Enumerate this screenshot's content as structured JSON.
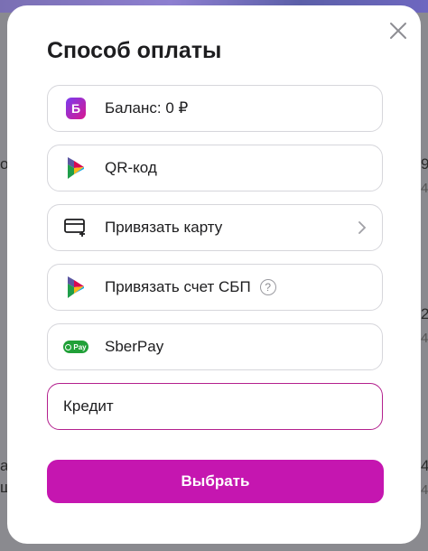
{
  "background": {
    "left_fragments": [
      "о",
      "а",
      "ш"
    ],
    "right_fragments": [
      "9",
      "4",
      "2",
      "4",
      "4",
      "4"
    ]
  },
  "modal": {
    "title": "Способ оплаты",
    "options": [
      {
        "label": "Баланс: 0 ₽",
        "icon": "balance-icon",
        "icon_letter": "Б"
      },
      {
        "label": "QR-код",
        "icon": "sbp-icon"
      },
      {
        "label": "Привязать карту",
        "icon": "card-add-icon",
        "chevron": true
      },
      {
        "label": "Привязать счет СБП",
        "icon": "sbp-icon",
        "help": "?"
      },
      {
        "label": "SberPay",
        "icon": "sberpay-icon",
        "badge_text": "Pay"
      },
      {
        "label": "Кредит",
        "selected": true
      }
    ],
    "submit_label": "Выбрать"
  },
  "colors": {
    "accent": "#c516b0",
    "selected_border": "#b3208e",
    "sberpay_green": "#21a038"
  }
}
